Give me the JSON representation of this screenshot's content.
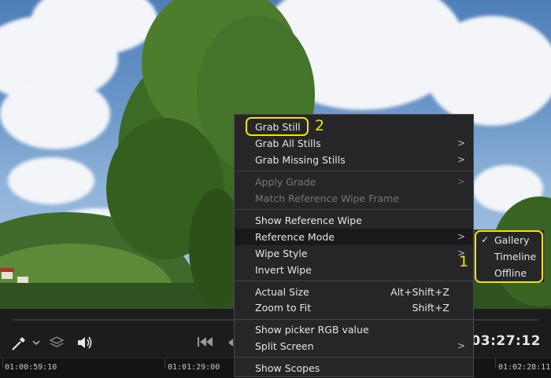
{
  "context_menu": {
    "grab_still": "Grab Still",
    "grab_all_stills": "Grab All Stills",
    "grab_missing_stills": "Grab Missing Stills",
    "apply_grade": "Apply Grade",
    "match_reference_wipe_frame": "Match Reference Wipe Frame",
    "show_reference_wipe": "Show Reference Wipe",
    "reference_mode": "Reference Mode",
    "wipe_style": "Wipe Style",
    "invert_wipe": "Invert Wipe",
    "actual_size": "Actual Size",
    "actual_size_shortcut": "Alt+Shift+Z",
    "zoom_to_fit": "Zoom to Fit",
    "zoom_to_fit_shortcut": "Shift+Z",
    "show_picker_rgb": "Show picker RGB value",
    "split_screen": "Split Screen",
    "show_scopes": "Show Scopes"
  },
  "reference_mode_submenu": {
    "gallery": "Gallery",
    "timeline": "Timeline",
    "offline": "Offline",
    "checkmark": "✓"
  },
  "callouts": {
    "one": "1",
    "two": "2"
  },
  "transport": {
    "timecode": "01:03:27:12"
  },
  "timeline": {
    "tc_left": "01:00:59:10",
    "tc_mid": "01:01:29:00",
    "tc_right": "01:02:28:11"
  },
  "colors": {
    "menu_bg": "#262628",
    "highlight": "#19191b",
    "annotation_yellow": "#f2e600"
  },
  "icons": [
    "picker-icon",
    "chevron-down-icon",
    "layers-icon",
    "speaker-icon",
    "skip-back-icon",
    "submenu-arrow-icon",
    "checkmark-icon"
  ]
}
